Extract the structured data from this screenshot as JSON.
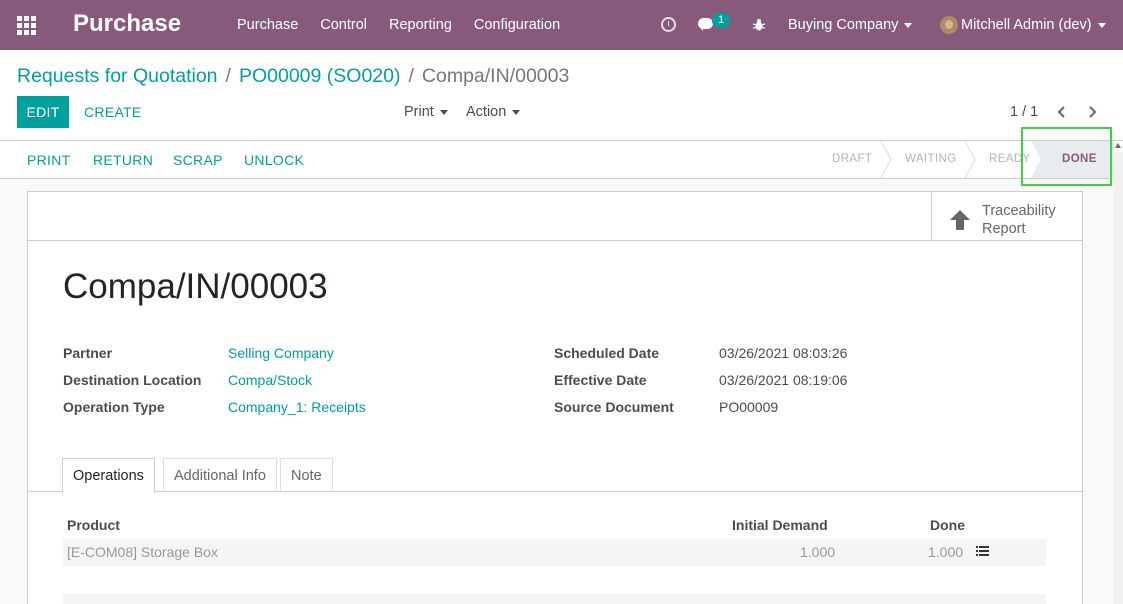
{
  "navbar": {
    "app_name": "Purchase",
    "menu": [
      "Purchase",
      "Control",
      "Reporting",
      "Configuration"
    ],
    "message_badge": "1",
    "company": "Buying Company",
    "user": "Mitchell Admin (dev)",
    "color": "#875a7b"
  },
  "breadcrumb": {
    "first": "Requests for Quotation",
    "second": "PO00009 (SO020)",
    "separator": "/",
    "current": "Compa/IN/00003"
  },
  "buttons": {
    "edit": "EDIT",
    "create": "CREATE",
    "print": "Print",
    "action": "Action"
  },
  "pager": {
    "value": "1 / 1"
  },
  "statusbar": {
    "actions": [
      "PRINT",
      "RETURN",
      "SCRAP",
      "UNLOCK"
    ],
    "stages": [
      "DRAFT",
      "WAITING",
      "READY",
      "DONE"
    ],
    "current_stage": "DONE"
  },
  "smart_button": {
    "label": "Traceability Report"
  },
  "record": {
    "title": "Compa/IN/00003",
    "fields_left": [
      {
        "label": "Partner",
        "value": "Selling Company"
      },
      {
        "label": "Destination Location",
        "value": "Compa/Stock"
      },
      {
        "label": "Operation Type",
        "value": "Company_1: Receipts"
      }
    ],
    "fields_right": [
      {
        "label": "Scheduled Date",
        "value": "03/26/2021 08:03:26"
      },
      {
        "label": "Effective Date",
        "value": "03/26/2021 08:19:06"
      },
      {
        "label": "Source Document",
        "value": "PO00009"
      }
    ]
  },
  "tabs": [
    "Operations",
    "Additional Info",
    "Note"
  ],
  "operations": {
    "columns": [
      "Product",
      "Initial Demand",
      "Done"
    ],
    "rows": [
      {
        "product": "[E-COM08] Storage Box",
        "initial_demand": "1.000",
        "done": "1.000"
      }
    ]
  },
  "colors": {
    "accent": "#00a09d",
    "brand": "#875a7b"
  }
}
